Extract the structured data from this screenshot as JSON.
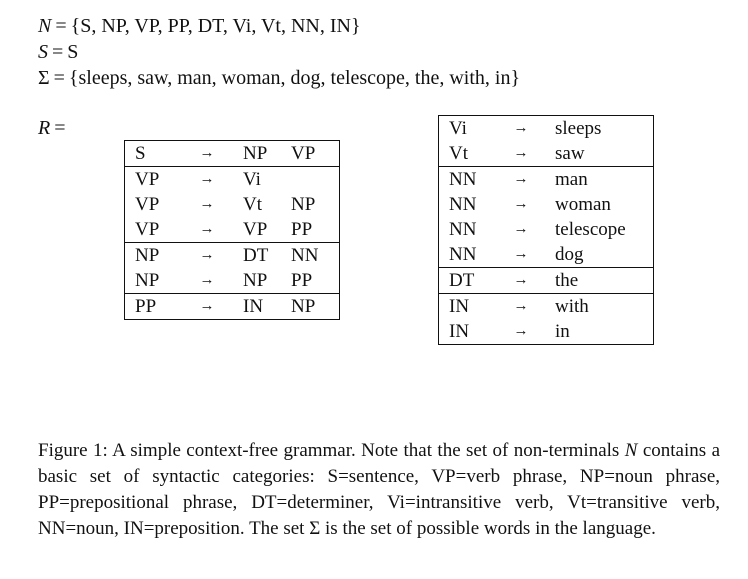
{
  "definitions": {
    "n_symbol": "N",
    "n_value": "{S, NP, VP, PP, DT, Vi, Vt, NN, IN}",
    "s_symbol": "S",
    "s_value": "S",
    "sigma_symbol": "Σ",
    "sigma_value": "{sleeps, saw, man, woman, dog, telescope, the, with, in}",
    "r_symbol": "R",
    "equals": "="
  },
  "rules_left": {
    "groups": [
      [
        {
          "lhs": "S",
          "arrow": "→",
          "rhs1": "NP",
          "rhs2": "VP"
        }
      ],
      [
        {
          "lhs": "VP",
          "arrow": "→",
          "rhs1": "Vi",
          "rhs2": ""
        },
        {
          "lhs": "VP",
          "arrow": "→",
          "rhs1": "Vt",
          "rhs2": "NP"
        },
        {
          "lhs": "VP",
          "arrow": "→",
          "rhs1": "VP",
          "rhs2": "PP"
        }
      ],
      [
        {
          "lhs": "NP",
          "arrow": "→",
          "rhs1": "DT",
          "rhs2": "NN"
        },
        {
          "lhs": "NP",
          "arrow": "→",
          "rhs1": "NP",
          "rhs2": "PP"
        }
      ],
      [
        {
          "lhs": "PP",
          "arrow": "→",
          "rhs1": "IN",
          "rhs2": "NP"
        }
      ]
    ]
  },
  "rules_right": {
    "groups": [
      [
        {
          "lhs": "Vi",
          "arrow": "→",
          "rhs1": "sleeps"
        },
        {
          "lhs": "Vt",
          "arrow": "→",
          "rhs1": "saw"
        }
      ],
      [
        {
          "lhs": "NN",
          "arrow": "→",
          "rhs1": "man"
        },
        {
          "lhs": "NN",
          "arrow": "→",
          "rhs1": "woman"
        },
        {
          "lhs": "NN",
          "arrow": "→",
          "rhs1": "telescope"
        },
        {
          "lhs": "NN",
          "arrow": "→",
          "rhs1": "dog"
        }
      ],
      [
        {
          "lhs": "DT",
          "arrow": "→",
          "rhs1": "the"
        }
      ],
      [
        {
          "lhs": "IN",
          "arrow": "→",
          "rhs1": "with"
        },
        {
          "lhs": "IN",
          "arrow": "→",
          "rhs1": "in"
        }
      ]
    ]
  },
  "caption": {
    "label": "Figure 1:",
    "text_1": "A simple context-free grammar. Note that the set of non-terminals",
    "n_symbol": "N",
    "text_2": "contains a basic set of syntactic categories: S=sentence, VP=verb phrase, NP=noun phrase, PP=prepositional phrase, DT=determiner, Vi=intransitive verb, Vt=transitive verb, NN=noun, IN=preposition. The set",
    "sigma_symbol": "Σ",
    "text_3": "is the set of possible words in the language."
  }
}
